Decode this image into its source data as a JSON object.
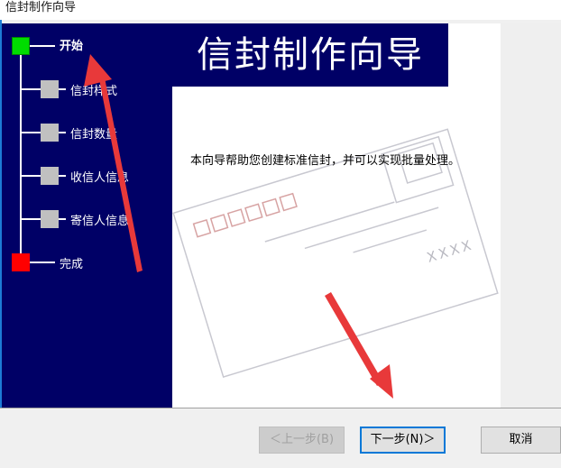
{
  "window": {
    "title": "信封制作向导"
  },
  "wizard": {
    "steps": [
      {
        "label": "开始",
        "state": "current",
        "color": "#00dd00"
      },
      {
        "label": "信封样式",
        "state": "pending",
        "color": "#c0c0c0"
      },
      {
        "label": "信封数量",
        "state": "pending",
        "color": "#c0c0c0"
      },
      {
        "label": "收信人信息",
        "state": "pending",
        "color": "#c0c0c0"
      },
      {
        "label": "寄信人信息",
        "state": "pending",
        "color": "#c0c0c0"
      },
      {
        "label": "完成",
        "state": "end",
        "color": "#ff0000"
      }
    ],
    "banner_title": "信封制作向导",
    "description": "本向导帮助您创建标准信封，并可以实现批量处理。"
  },
  "envelope": {
    "recipient_mark": "XXXX"
  },
  "buttons": {
    "back": "＜上一步(B)",
    "next": "下一步(N)＞",
    "cancel": "取消"
  },
  "colors": {
    "nav_background": "#000066",
    "annotation_arrow": "#e8393a",
    "default_button_border": "#0078d7"
  }
}
